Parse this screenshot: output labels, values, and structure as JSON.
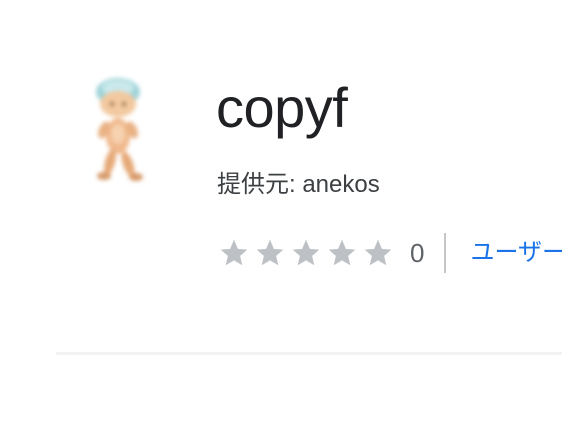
{
  "extension": {
    "name": "copyf",
    "publisher": "提供元: anekos",
    "icon": "walking-character-icon"
  },
  "rating": {
    "stars": 0,
    "max_stars": 5,
    "count": "0",
    "reviews_link_label": "ユーザー"
  },
  "colors": {
    "title": "#202124",
    "star_empty": "#bdc1c6",
    "link": "#1a73e8"
  }
}
